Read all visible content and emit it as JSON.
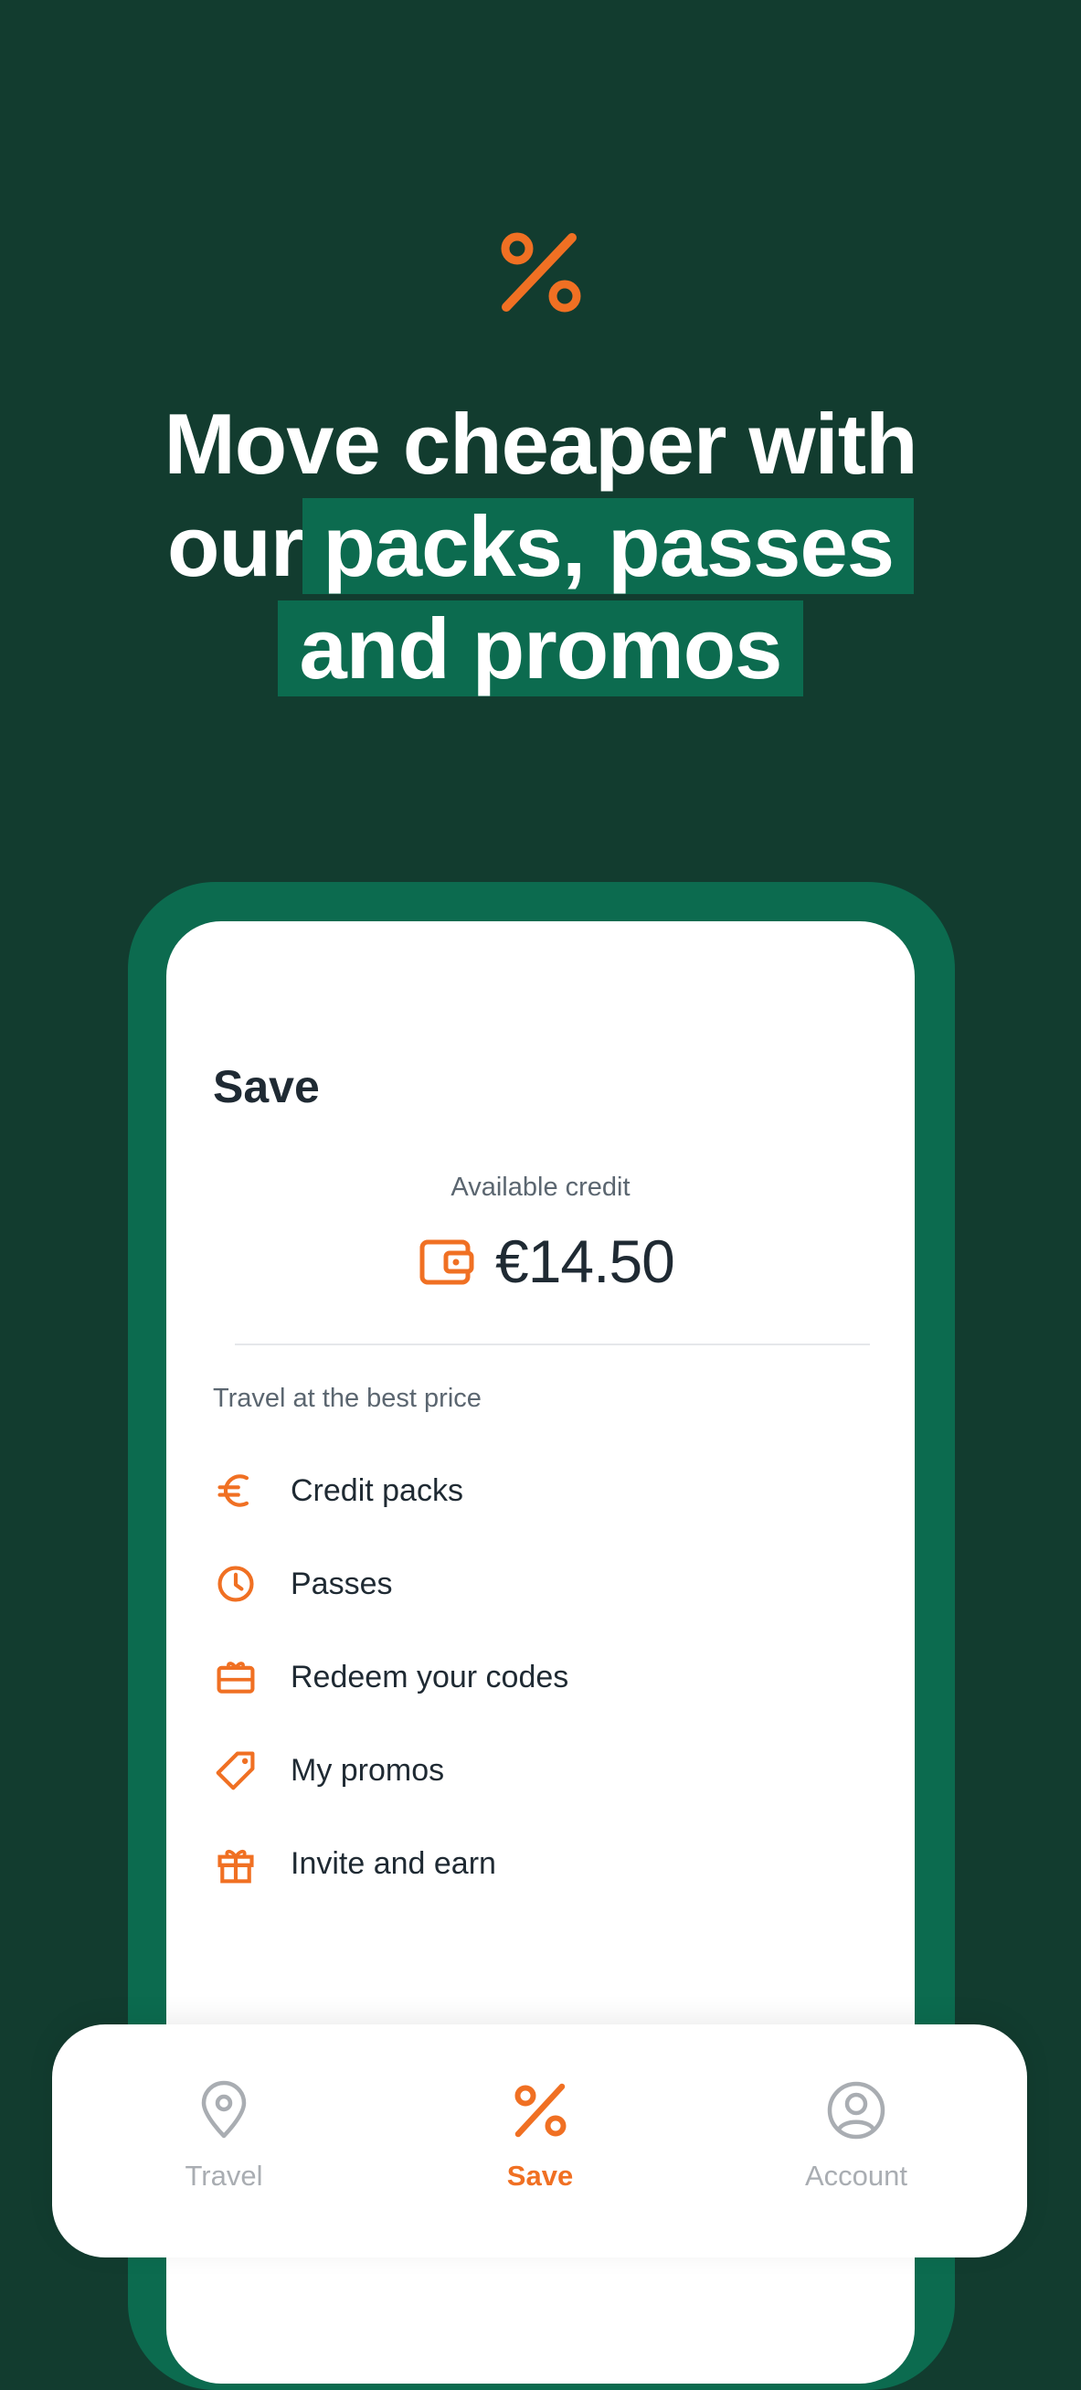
{
  "hero": {
    "icon": "percent-icon",
    "headline_line1": "Move cheaper with",
    "headline_line2_plain": "our",
    "headline_line2_highlight": "packs, passes",
    "headline_line3_highlight": "and promos"
  },
  "colors": {
    "background": "#123c2f",
    "highlight": "#0c6b4f",
    "accent": "#f07023",
    "text_dark": "#1f2a33",
    "inactive": "#a9adb2"
  },
  "screen": {
    "title": "Save",
    "credit_label": "Available credit",
    "credit_icon": "wallet-icon",
    "credit_amount": "€14.50",
    "section_label": "Travel at the best price",
    "menu": [
      {
        "label": "Credit packs",
        "icon": "euro-icon"
      },
      {
        "label": "Passes",
        "icon": "clock-icon"
      },
      {
        "label": "Redeem your codes",
        "icon": "ticket-icon"
      },
      {
        "label": "My promos",
        "icon": "tag-icon"
      },
      {
        "label": "Invite and earn",
        "icon": "gift-icon"
      }
    ]
  },
  "nav": {
    "items": [
      {
        "label": "Travel",
        "icon": "location-pin-icon",
        "active": false
      },
      {
        "label": "Save",
        "icon": "percent-icon",
        "active": true
      },
      {
        "label": "Account",
        "icon": "user-circle-icon",
        "active": false
      }
    ]
  }
}
